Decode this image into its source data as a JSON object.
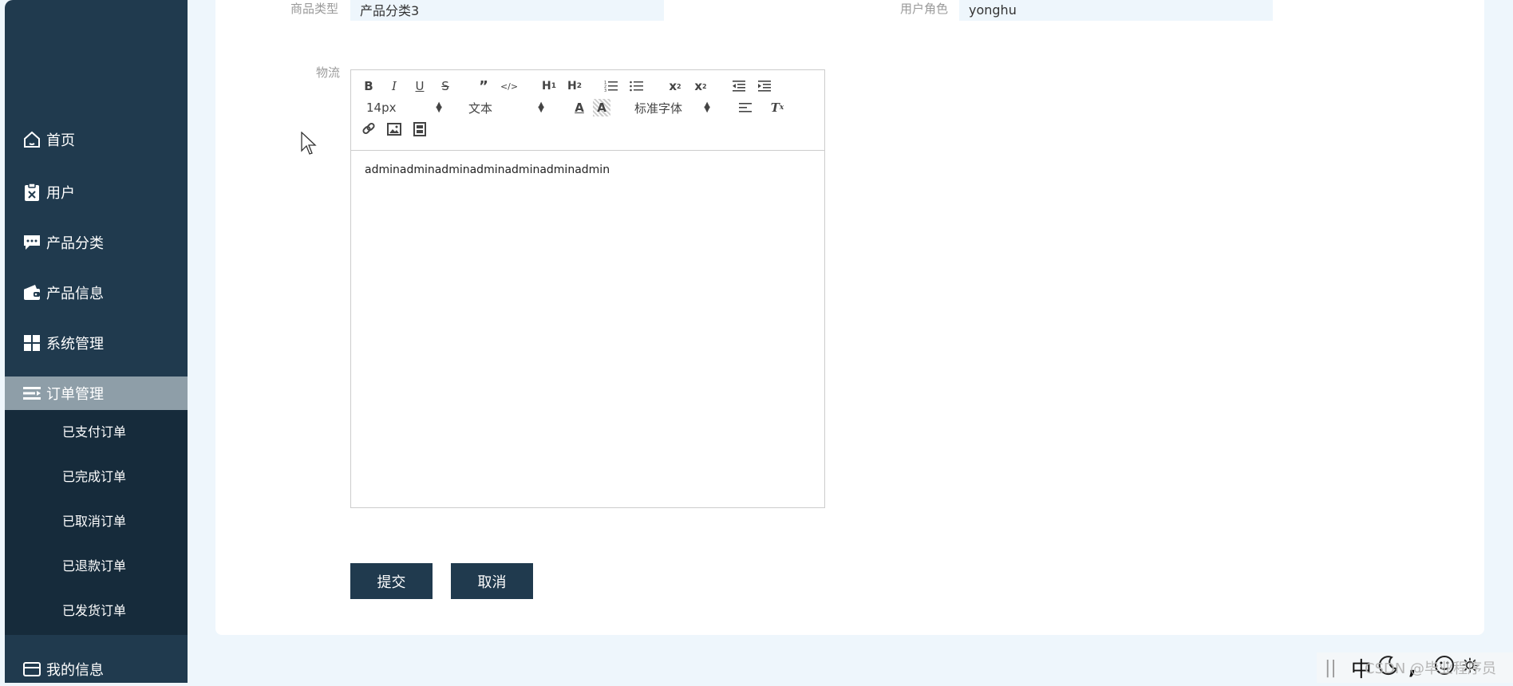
{
  "sidebar": {
    "items": [
      {
        "label": "首页",
        "icon": "home-icon"
      },
      {
        "label": "用户",
        "icon": "clipboard-x-icon"
      },
      {
        "label": "产品分类",
        "icon": "chat-icon"
      },
      {
        "label": "产品信息",
        "icon": "wallet-icon"
      },
      {
        "label": "系统管理",
        "icon": "grid-icon"
      },
      {
        "label": "订单管理",
        "icon": "list-icon",
        "active": true
      },
      {
        "label": "我的信息",
        "icon": "card-icon"
      }
    ],
    "submenu": [
      "已支付订单",
      "已完成订单",
      "已取消订单",
      "已退款订单",
      "已发货订单"
    ]
  },
  "form": {
    "category_label": "商品类型",
    "category_value": "产品分类3",
    "role_label": "用户角色",
    "role_value": "yonghu",
    "logistics_label": "物流",
    "editor": {
      "font_size": "14px",
      "format": "文本",
      "font_family": "标准字体",
      "content": "adminadminadminadminadminadminadmin"
    },
    "submit_label": "提交",
    "cancel_label": "取消"
  },
  "ime": {
    "mode": "中",
    "watermark": "CSDN @毕业程序员"
  },
  "colors": {
    "sidebar_bg": "#203a4e",
    "active_item_bg": "#8e9ea8",
    "button_bg": "#203a4e",
    "page_bg": "#eef6fc"
  }
}
